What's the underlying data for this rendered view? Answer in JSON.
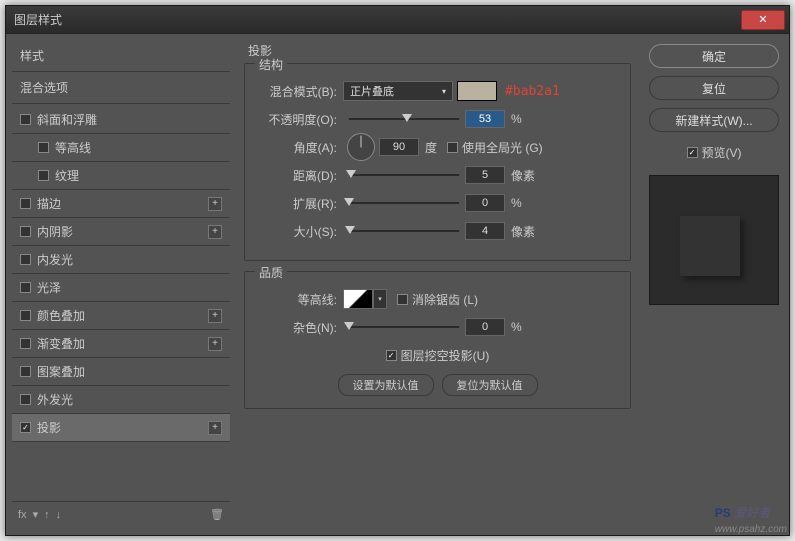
{
  "window": {
    "title": "图层样式"
  },
  "sidebar": {
    "styles_header": "样式",
    "blend_header": "混合选项",
    "items": [
      {
        "label": "斜面和浮雕",
        "checked": false,
        "add": false,
        "indent": false
      },
      {
        "label": "等高线",
        "checked": false,
        "add": false,
        "indent": true
      },
      {
        "label": "纹理",
        "checked": false,
        "add": false,
        "indent": true
      },
      {
        "label": "描边",
        "checked": false,
        "add": true,
        "indent": false
      },
      {
        "label": "内阴影",
        "checked": false,
        "add": true,
        "indent": false
      },
      {
        "label": "内发光",
        "checked": false,
        "add": false,
        "indent": false
      },
      {
        "label": "光泽",
        "checked": false,
        "add": false,
        "indent": false
      },
      {
        "label": "颜色叠加",
        "checked": false,
        "add": true,
        "indent": false
      },
      {
        "label": "渐变叠加",
        "checked": false,
        "add": true,
        "indent": false
      },
      {
        "label": "图案叠加",
        "checked": false,
        "add": false,
        "indent": false
      },
      {
        "label": "外发光",
        "checked": false,
        "add": false,
        "indent": false
      },
      {
        "label": "投影",
        "checked": true,
        "add": true,
        "indent": false,
        "active": true
      }
    ],
    "footer": {
      "fx": "fx",
      "trash": "🗑"
    }
  },
  "panel": {
    "title": "投影",
    "structure": {
      "legend": "结构",
      "blend_mode_label": "混合模式(B):",
      "blend_mode_value": "正片叠底",
      "color_hex_annot": "#bab2a1",
      "opacity_label": "不透明度(O):",
      "opacity_value": "53",
      "opacity_unit": "%",
      "angle_label": "角度(A):",
      "angle_value": "90",
      "angle_unit": "度",
      "global_light_label": "使用全局光 (G)",
      "distance_label": "距离(D):",
      "distance_value": "5",
      "distance_unit": "像素",
      "spread_label": "扩展(R):",
      "spread_value": "0",
      "spread_unit": "%",
      "size_label": "大小(S):",
      "size_value": "4",
      "size_unit": "像素"
    },
    "quality": {
      "legend": "品质",
      "contour_label": "等高线:",
      "antialias_label": "消除锯齿 (L)",
      "noise_label": "杂色(N):",
      "noise_value": "0",
      "noise_unit": "%"
    },
    "knockout_label": "图层挖空投影(U)",
    "set_default": "设置为默认值",
    "reset_default": "复位为默认值"
  },
  "right": {
    "ok": "确定",
    "cancel": "复位",
    "new_style": "新建样式(W)...",
    "preview_label": "预览(V)"
  },
  "watermark": {
    "text1": "PS",
    "text2": "爱好者",
    "url": "www.psahz.com"
  }
}
